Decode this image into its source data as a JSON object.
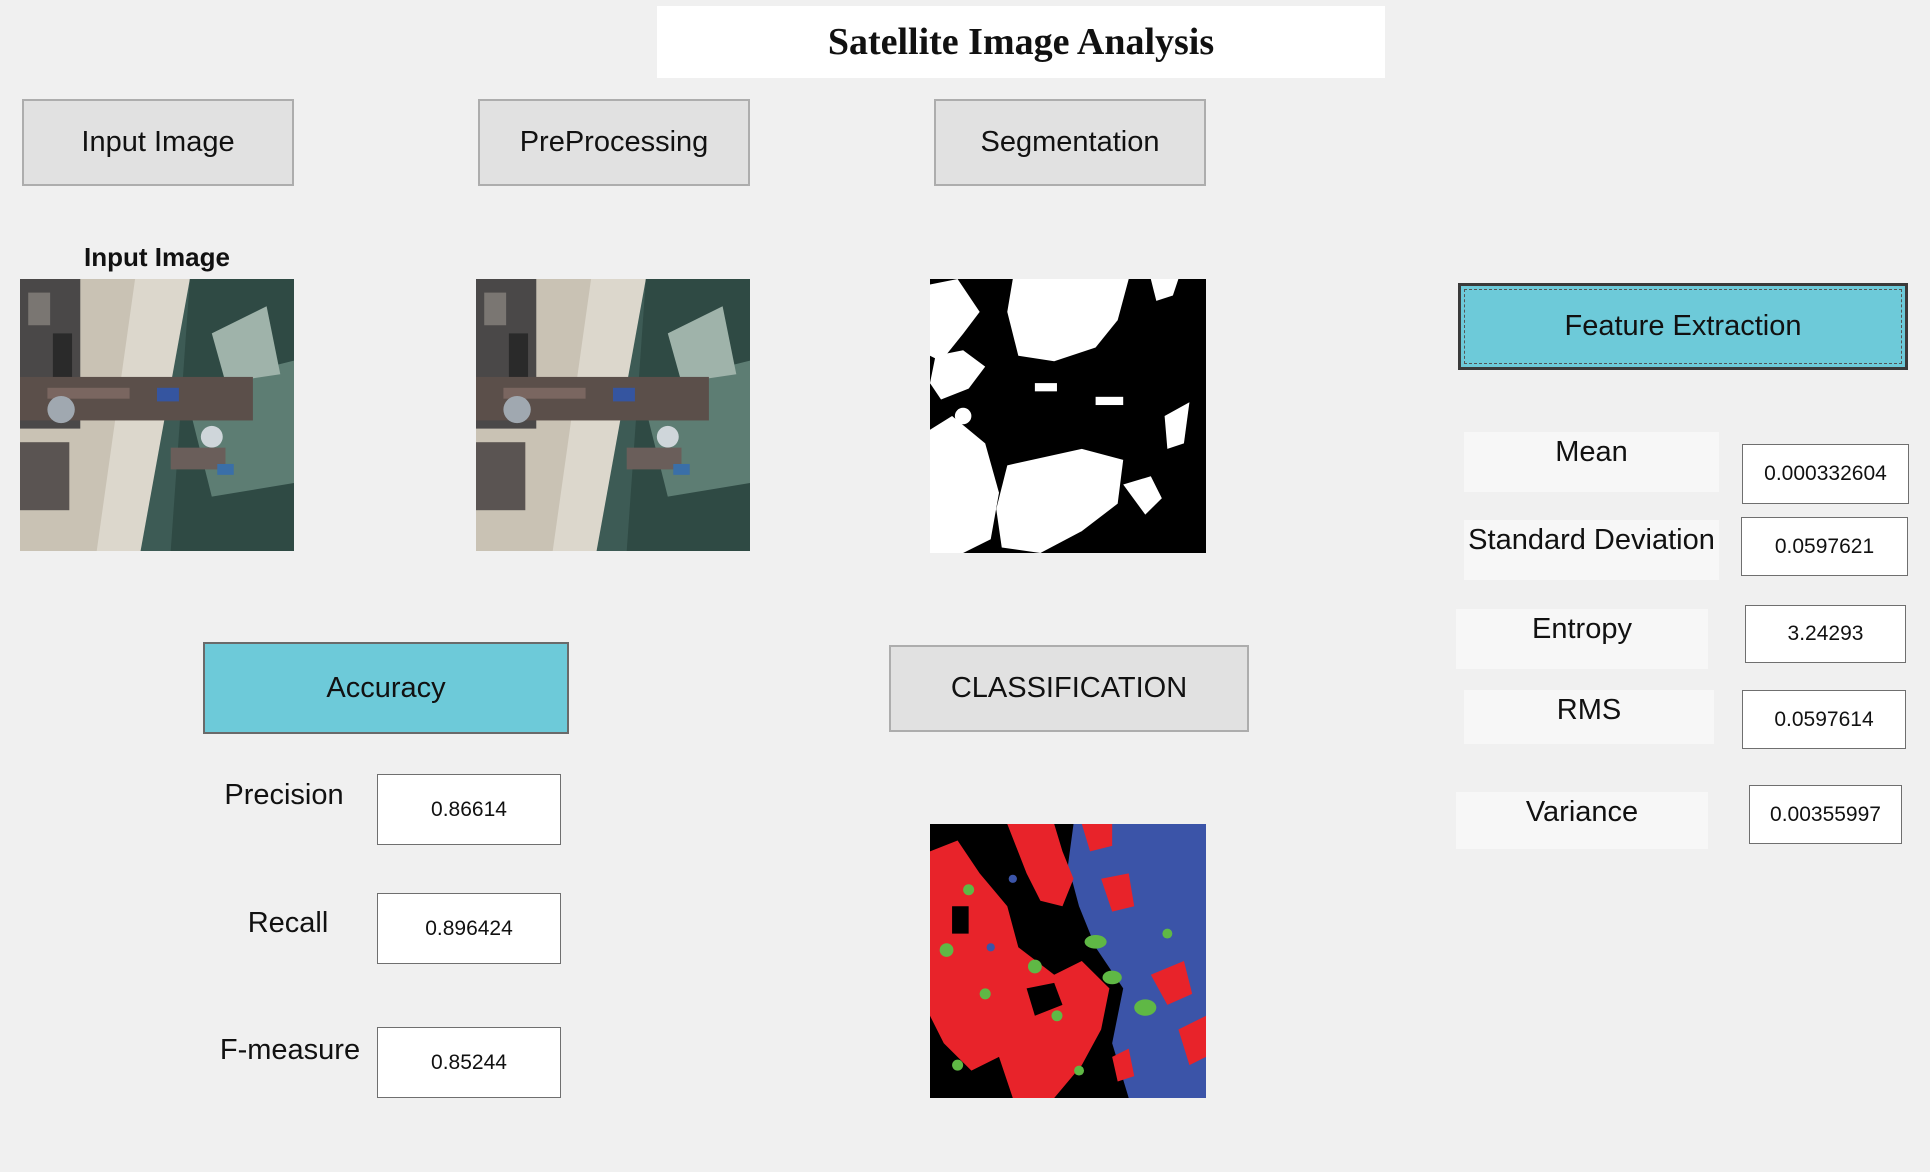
{
  "header": {
    "title": "Satellite Image Analysis"
  },
  "buttons": {
    "input_image": "Input Image",
    "preprocessing": "PreProcessing",
    "segmentation": "Segmentation",
    "feature_extraction": "Feature Extraction",
    "accuracy": "Accuracy",
    "classification": "CLASSIFICATION"
  },
  "panels": {
    "input_caption": "Input Image"
  },
  "features": {
    "mean": {
      "label": "Mean",
      "value": "0.000332604"
    },
    "std": {
      "label": "Standard Deviation",
      "value": "0.0597621"
    },
    "entropy": {
      "label": "Entropy",
      "value": "3.24293"
    },
    "rms": {
      "label": "RMS",
      "value": "0.0597614"
    },
    "variance": {
      "label": "Variance",
      "value": "0.00355997"
    }
  },
  "accuracy": {
    "precision": {
      "label": "Precision",
      "value": "0.86614"
    },
    "recall": {
      "label": "Recall",
      "value": "0.896424"
    },
    "fmeasure": {
      "label": "F-measure",
      "value": "0.85244"
    }
  },
  "colors": {
    "accent_button": "#6dcad9",
    "button_face": "#e1e1e1",
    "window_bg": "#f0f0f0",
    "class_red": "#e8232a",
    "class_blue": "#3b54a8",
    "class_green": "#5fb845"
  }
}
